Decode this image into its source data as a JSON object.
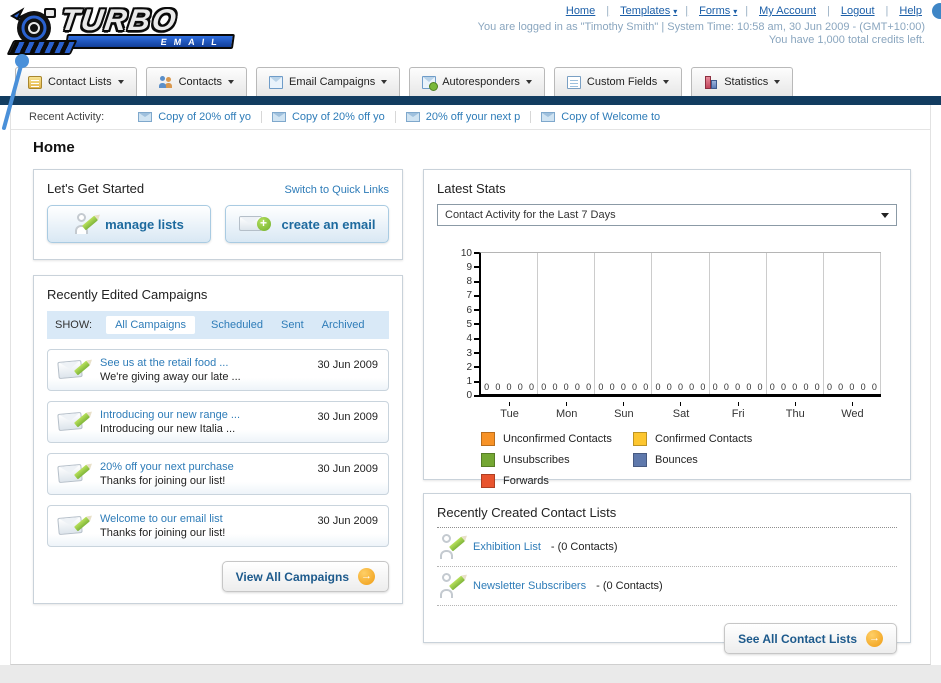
{
  "header": {
    "logo": {
      "title": "TURBO",
      "subtitle": "EMAIL"
    },
    "links": [
      {
        "label": "Home",
        "arrow": ""
      },
      {
        "label": "Templates",
        "arrow": "▾"
      },
      {
        "label": "Forms",
        "arrow": "▾"
      },
      {
        "label": "My Account",
        "arrow": ""
      },
      {
        "label": "Logout",
        "arrow": ""
      },
      {
        "label": "Help",
        "arrow": ""
      }
    ],
    "login_info": "You are logged in as \"Timothy Smith\" | System Time: 10:58 am, 30 Jun 2009 - (GMT+10:00)",
    "credits_info": "You have 1,000 total credits left."
  },
  "nav": {
    "tabs": [
      {
        "label": "Contact Lists",
        "icon": "contact-lists"
      },
      {
        "label": "Contacts",
        "icon": "contacts"
      },
      {
        "label": "Email Campaigns",
        "icon": "email-campaigns"
      },
      {
        "label": "Autoresponders",
        "icon": "autoresponders"
      },
      {
        "label": "Custom Fields",
        "icon": "custom-fields"
      },
      {
        "label": "Statistics",
        "icon": "statistics"
      }
    ]
  },
  "recent_activity": {
    "label": "Recent Activity:",
    "items": [
      "Copy of 20% off yo",
      "Copy of 20% off yo",
      "20% off your next p",
      "Copy of Welcome to"
    ]
  },
  "page_title": "Home",
  "get_started": {
    "title": "Let's Get Started",
    "switch_link": "Switch to Quick Links",
    "buttons": [
      {
        "label": "manage lists"
      },
      {
        "label": "create an email"
      }
    ]
  },
  "campaigns": {
    "title": "Recently Edited Campaigns",
    "filter_label": "SHOW:",
    "filters": [
      {
        "label": "All Campaigns",
        "active": true
      },
      {
        "label": "Scheduled",
        "active": false
      },
      {
        "label": "Sent",
        "active": false
      },
      {
        "label": "Archived",
        "active": false
      }
    ],
    "items": [
      {
        "title": "See us at the retail food ...",
        "subtitle": "We're giving away our late ...",
        "date": "30 Jun 2009"
      },
      {
        "title": "Introducing our new range ...",
        "subtitle": "Introducing our new Italia ...",
        "date": "30 Jun 2009"
      },
      {
        "title": "20% off your next purchase",
        "subtitle": "Thanks for joining our list!",
        "date": "30 Jun 2009"
      },
      {
        "title": "Welcome to our email list",
        "subtitle": "Thanks for joining our list!",
        "date": "30 Jun 2009"
      }
    ],
    "view_all_label": "View All Campaigns"
  },
  "stats": {
    "title": "Latest Stats",
    "dropdown_value": "Contact Activity for the Last 7 Days",
    "chart_data": {
      "type": "bar",
      "title": "Contact Activity for the Last 7 Days",
      "categories": [
        "Tue",
        "Mon",
        "Sun",
        "Sat",
        "Fri",
        "Thu",
        "Wed"
      ],
      "series": [
        {
          "name": "Unconfirmed Contacts",
          "color": "#f79226",
          "values": [
            0,
            0,
            0,
            0,
            0,
            0,
            0
          ]
        },
        {
          "name": "Confirmed Contacts",
          "color": "#fdc62f",
          "values": [
            0,
            0,
            0,
            0,
            0,
            0,
            0
          ]
        },
        {
          "name": "Unsubscribes",
          "color": "#74a733",
          "values": [
            0,
            0,
            0,
            0,
            0,
            0,
            0
          ]
        },
        {
          "name": "Bounces",
          "color": "#5f79ac",
          "values": [
            0,
            0,
            0,
            0,
            0,
            0,
            0
          ]
        },
        {
          "name": "Forwards",
          "color": "#e8542e",
          "values": [
            0,
            0,
            0,
            0,
            0,
            0,
            0
          ]
        }
      ],
      "ylim": [
        0,
        10
      ],
      "yticks": [
        0,
        1,
        2,
        3,
        4,
        5,
        6,
        7,
        8,
        9,
        10
      ],
      "grid": "vertical",
      "legend_position": "bottom"
    }
  },
  "contact_lists": {
    "title": "Recently Created Contact Lists",
    "items": [
      {
        "name": "Exhibition List",
        "detail": "- (0 Contacts)"
      },
      {
        "name": "Newsletter Subscribers",
        "detail": "- (0 Contacts)"
      }
    ],
    "see_all_label": "See All Contact Lists"
  }
}
